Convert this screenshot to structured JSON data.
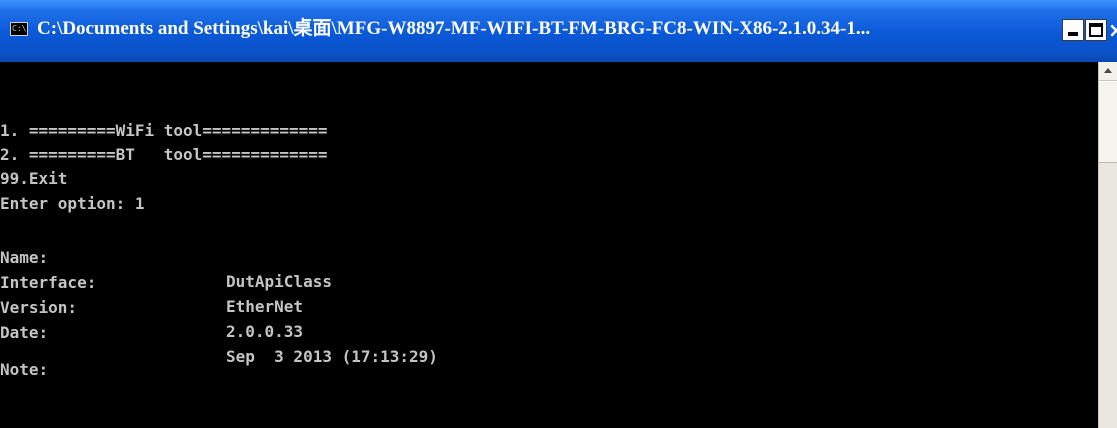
{
  "window": {
    "title": "C:\\Documents and Settings\\kai\\桌面\\MFG-W8897-MF-WIFI-BT-FM-BRG-FC8-WIN-X86-2.1.0.34-1...",
    "icon_glyph": "C:\\",
    "minimize_icon": "minimize-icon",
    "maximize_icon": "maximize-icon",
    "close_label": "×"
  },
  "console": {
    "menu_lines": [
      "1. =========WiFi tool=============",
      "2. =========BT   tool=============",
      "99.Exit",
      "Enter option: 1"
    ],
    "info": [
      {
        "label": "Name:",
        "value": "DutApiClass"
      },
      {
        "label": "Interface:",
        "value": "EtherNet"
      },
      {
        "label": "Version:",
        "value": "2.0.0.33"
      },
      {
        "label": "Date:",
        "value": "Sep  3 2013 (17:13:29)"
      }
    ],
    "note_label": "Note:"
  },
  "colors": {
    "titlebar": "#0a58d6",
    "console_bg": "#000000",
    "console_text": "#c4c4c4",
    "scrollbar": "#e9e7df"
  }
}
